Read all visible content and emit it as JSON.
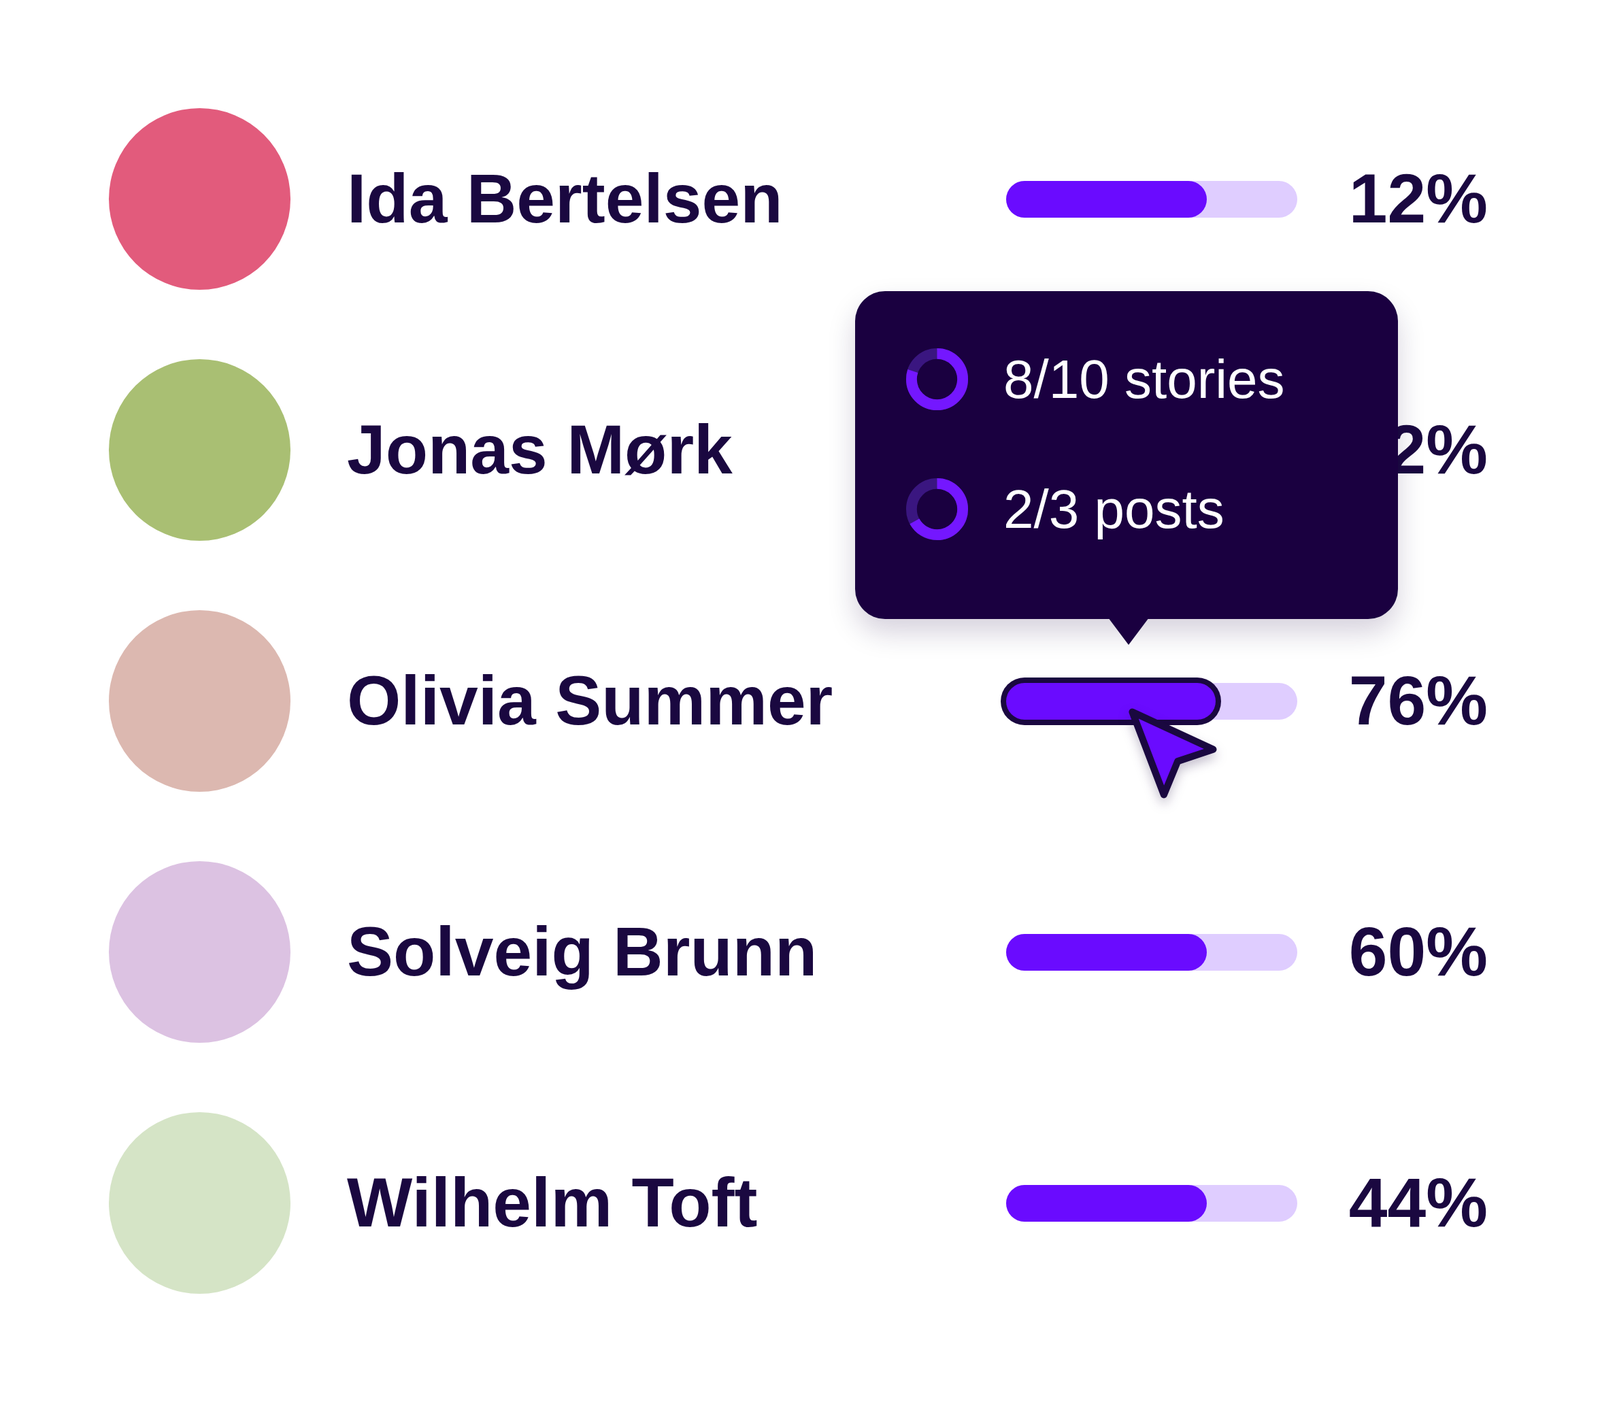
{
  "people": [
    {
      "name": "Ida Bertelsen",
      "percent": "12%",
      "level": 0.69,
      "hovered": false,
      "color": "#e25b7c"
    },
    {
      "name": "Jonas Mørk",
      "percent": "2%",
      "hovered": false,
      "color": "#a9bf73"
    },
    {
      "name": "Olivia Summer",
      "percent": "76%",
      "level": 0.72,
      "hovered": true,
      "color": "#dcb8b0"
    },
    {
      "name": "Solveig Brunn",
      "percent": "60%",
      "level": 0.69,
      "hovered": false,
      "color": "#dcc2e2"
    },
    {
      "name": "Wilhelm Toft",
      "percent": "44%",
      "level": 0.69,
      "hovered": false,
      "color": "#d5e4c6"
    }
  ],
  "tooltip": {
    "items": [
      {
        "label": "8/10 stories",
        "level": 0.8
      },
      {
        "label": "2/3 posts",
        "level": 0.67
      }
    ]
  }
}
